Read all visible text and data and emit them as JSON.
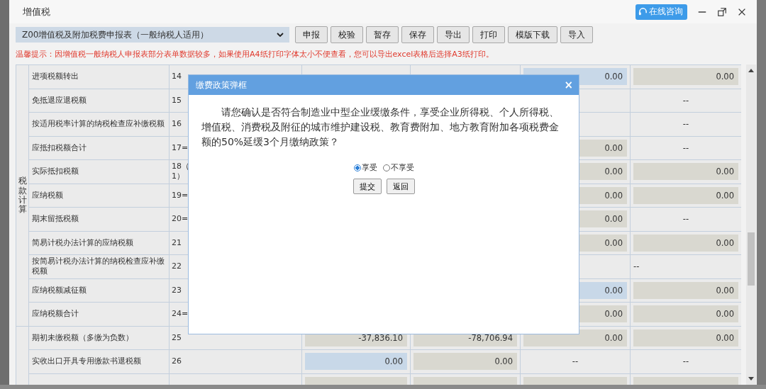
{
  "window": {
    "title": "增值税",
    "consult_button": "在线咨询"
  },
  "toolbar": {
    "form_select": "Z00增值税及附加税费申报表（一般纳税人适用）",
    "buttons": [
      "申报",
      "校验",
      "暂存",
      "保存",
      "导出",
      "打印",
      "模版下载",
      "导入"
    ]
  },
  "notice": "温馨提示：因增值税一般纳税人申报表部分表单数据较多，如果使用A4纸打印字体太小不便查看，您可以导出excel表格后选择A3纸打印。",
  "table": {
    "groups": [
      {
        "label": "税款计算",
        "rows": [
          {
            "name": "进项税额转出",
            "line": "14",
            "cells": [
              {
                "kind": "input",
                "text": "0.00"
              },
              {
                "kind": "calc",
                "text": "0.00"
              }
            ]
          },
          {
            "name": "免抵退应退税额",
            "line": "15",
            "cells": [
              {
                "kind": "blank"
              },
              {
                "kind": "dash",
                "text": "--"
              }
            ]
          },
          {
            "name": "按适用税率计算的纳税检查应补缴税额",
            "line": "16",
            "cells": [
              {
                "kind": "blank"
              },
              {
                "kind": "dash",
                "text": "--"
              }
            ]
          },
          {
            "name": "应抵扣税额合计",
            "line": "17=",
            "cells": [
              {
                "kind": "calc",
                "text": "0.00"
              },
              {
                "kind": "dash",
                "text": "--"
              }
            ]
          },
          {
            "name": "实际抵扣税额",
            "line": "18（\n1）",
            "cells": [
              {
                "kind": "calc",
                "text": "0.00"
              },
              {
                "kind": "calc",
                "text": "0.00"
              }
            ]
          },
          {
            "name": "应纳税额",
            "line": "19=",
            "cells": [
              {
                "kind": "calc",
                "text": "0.00"
              },
              {
                "kind": "calc",
                "text": "0.00"
              }
            ]
          },
          {
            "name": "期末留抵税额",
            "line": "20=",
            "cells": [
              {
                "kind": "calc",
                "text": "0.00"
              },
              {
                "kind": "dash",
                "text": "--"
              }
            ]
          },
          {
            "name": "简易计税办法计算的应纳税额",
            "line": "21",
            "cells": [
              {
                "kind": "calc",
                "text": "0.00"
              },
              {
                "kind": "calc",
                "text": "0.00"
              }
            ]
          },
          {
            "name": "按简易计税办法计算的纳税检查应补缴税额",
            "line": "22",
            "cells": [
              {
                "kind": "blank"
              },
              {
                "kind": "note",
                "text": "--"
              }
            ]
          },
          {
            "name": "应纳税额减征额",
            "line": "23",
            "cells": [
              {
                "kind": "input",
                "text": "0.00"
              },
              {
                "kind": "calc",
                "text": "0.00"
              }
            ]
          },
          {
            "name": "应纳税额合计",
            "line": "24=",
            "cells": [
              {
                "kind": "calc",
                "text": "0.00"
              },
              {
                "kind": "calc",
                "text": "0.00"
              }
            ]
          }
        ]
      },
      {
        "rows": [
          {
            "name": "期初未缴税额（多缴为负数）",
            "line": "25",
            "cells": [
              {
                "kind": "calc",
                "text": "-37,836.10"
              },
              {
                "kind": "calc",
                "text": "-78,706.94"
              },
              {
                "kind": "calc",
                "text": "0.00"
              },
              {
                "kind": "calc",
                "text": "0.00"
              }
            ]
          },
          {
            "name": "实收出口开具专用缴款书退税额",
            "line": "26",
            "cells": [
              {
                "kind": "input",
                "text": "0.00"
              },
              {
                "kind": "calc",
                "text": "0.00"
              },
              {
                "kind": "dash",
                "text": "--"
              },
              {
                "kind": "dash",
                "text": "--"
              }
            ]
          },
          {
            "cells": [
              {
                "kind": "calc"
              },
              {
                "kind": "calc"
              },
              {
                "kind": "calc"
              },
              {
                "kind": "calc"
              }
            ]
          }
        ]
      }
    ]
  },
  "dialog": {
    "title": "缴费政策弹框",
    "close": "×",
    "message": "请您确认是否符合制造业中型企业缓缴条件，享受企业所得税、个人所得税、增值税、消费税及附征的城市维护建设税、教育费附加、地方教育附加各项税费金额的50%延缓3个月缴纳政策？",
    "options": [
      {
        "label": "享受",
        "selected": true
      },
      {
        "label": "不享受",
        "selected": false
      }
    ],
    "buttons": [
      "提交",
      "返回"
    ]
  }
}
